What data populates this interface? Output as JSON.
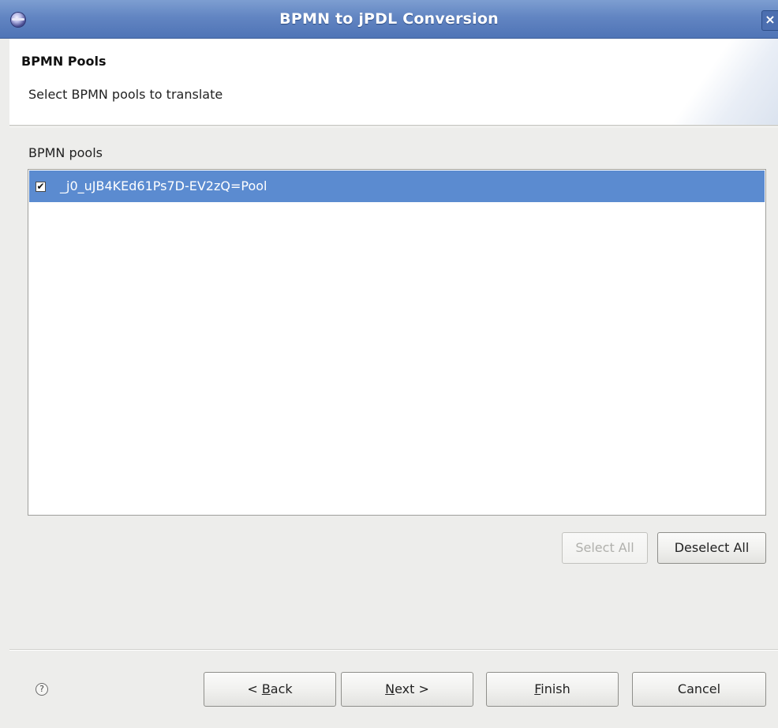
{
  "window": {
    "title": "BPMN to jPDL Conversion",
    "close_label": "×"
  },
  "header": {
    "title": "BPMN Pools",
    "description": "Select BPMN pools to translate"
  },
  "pools": {
    "label": "BPMN pools",
    "items": [
      {
        "name": "_j0_uJB4KEd61Ps7D-EV2zQ=Pool",
        "checked": true,
        "check_glyph": "✔"
      }
    ]
  },
  "selection_buttons": {
    "select_all": "Select All",
    "deselect_all": "Deselect All"
  },
  "footer": {
    "help_glyph": "?",
    "back": {
      "prefix": "< ",
      "mnemonic": "B",
      "rest": "ack"
    },
    "next": {
      "mnemonic": "N",
      "rest": "ext >"
    },
    "finish": {
      "mnemonic": "F",
      "rest": "inish"
    },
    "cancel": "Cancel"
  },
  "colors": {
    "titlebar": "#6285c2",
    "selection": "#5b8bd0",
    "window_bg": "#ededeb"
  },
  "icons": {
    "app": "eclipse-icon",
    "close": "close-icon",
    "help": "help-icon",
    "checkbox": "checkbox-checked-icon"
  }
}
